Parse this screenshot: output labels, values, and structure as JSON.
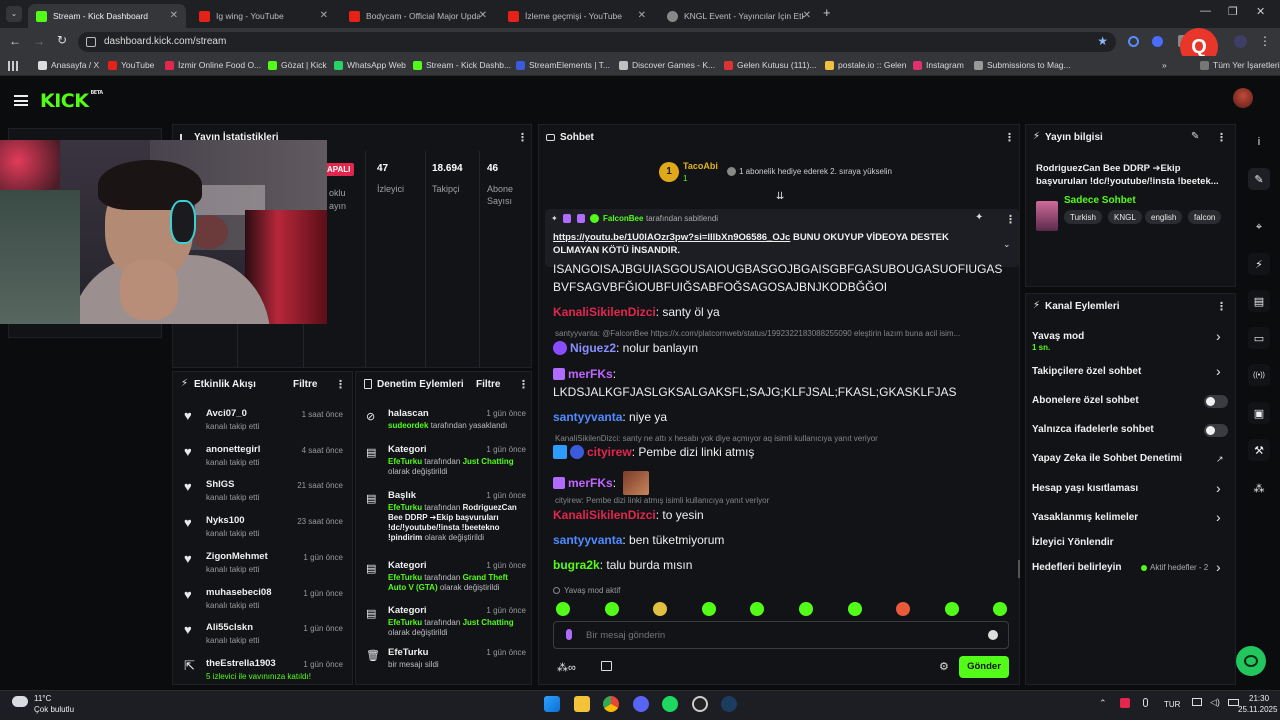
{
  "browser": {
    "tabs": [
      {
        "label": "Stream - Kick Dashboard",
        "icon": "kick-icon",
        "active": true
      },
      {
        "label": "Ig wing - YouTube",
        "icon": "youtube-icon"
      },
      {
        "label": "Bodycam - Official Major Upda",
        "icon": "youtube-icon"
      },
      {
        "label": "İzleme geçmişi - YouTube",
        "icon": "youtube-icon"
      },
      {
        "label": "KNGL Event - Yayıncılar İçin Etk",
        "icon": "globe-icon"
      }
    ],
    "url": "dashboard.kick.com/stream",
    "bookmarks": [
      "Anasayfa / X",
      "YouTube",
      "İzmir Online Food O...",
      "Gözat | Kick",
      "WhatsApp Web",
      "Stream - Kick Dashb...",
      "StreamElements | T...",
      "Discover Games - K...",
      "Gelen Kutusu (111)...",
      "postale.io :: Gelen",
      "Instagram",
      "Submissions to Mag..."
    ],
    "bookmarks_all": "Tüm Yer İşaretleri"
  },
  "kick": {
    "logo": "KICK",
    "beta": "BETA"
  },
  "stats": {
    "title": "Yayın İstatistikleri",
    "status": "APALI",
    "col1_label": [
      "oklu",
      "ayın"
    ],
    "items": [
      {
        "value": "47",
        "label": "İzleyici"
      },
      {
        "value": "18.694",
        "label": "Takipçi"
      },
      {
        "value": "46",
        "label": "Abone Sayısı"
      }
    ]
  },
  "activity": {
    "title": "Etkinlik Akışı",
    "filter": "Filtre",
    "items": [
      {
        "name": "Avci07_0",
        "sub": "kanalı takip etti",
        "time": "1 saat önce"
      },
      {
        "name": "anonettegirl",
        "sub": "kanalı takip etti",
        "time": "4 saat önce"
      },
      {
        "name": "ShIGS",
        "sub": "kanalı takip etti",
        "time": "21 saat önce"
      },
      {
        "name": "Nyks100",
        "sub": "kanalı takip etti",
        "time": "23 saat önce"
      },
      {
        "name": "ZigonMehmet",
        "sub": "kanalı takip etti",
        "time": "1 gün önce"
      },
      {
        "name": "muhasebeci08",
        "sub": "kanalı takip etti",
        "time": "1 gün önce"
      },
      {
        "name": "Ali55clskn",
        "sub": "kanalı takip etti",
        "time": "1 gün önce"
      },
      {
        "name": "theEstrella1903",
        "sub": "5 izlevici ile vavınınıza katıldı!",
        "time": "1 gün önce",
        "raid": true
      }
    ]
  },
  "moderation": {
    "title": "Denetim Eylemleri",
    "filter": "Filtre",
    "items": [
      {
        "title": "halascan",
        "time": "1 gün önce",
        "icon": "ban-icon",
        "lines": [
          [
            "sudeordek",
            "g"
          ],
          [
            " tarafından yasaklandı",
            "n"
          ]
        ]
      },
      {
        "title": "Kategori",
        "time": "1 gün önce",
        "icon": "category-icon",
        "lines": [
          [
            "EfeTurku",
            "g"
          ],
          [
            " tarafından ",
            "n"
          ],
          [
            "Just Chatting",
            "g"
          ],
          [
            " olarak değiştirildi",
            "n"
          ]
        ]
      },
      {
        "title": "Başlık",
        "time": "1 gün önce",
        "icon": "title-icon",
        "lines": [
          [
            "EfeTurku",
            "g"
          ],
          [
            " tarafından ",
            "n"
          ],
          [
            "RodriguezCan Bee DDRP ➔Ekip başvuruları !dc/!youtube/!insta !beetekno !pindirim",
            "w"
          ],
          [
            " olarak değiştirildi",
            "n"
          ]
        ]
      },
      {
        "title": "Kategori",
        "time": "1 gün önce",
        "icon": "category-icon",
        "lines": [
          [
            "EfeTurku",
            "g"
          ],
          [
            " tarafından ",
            "n"
          ],
          [
            "Grand Theft Auto V (GTA)",
            "g"
          ],
          [
            " olarak değiştirildi",
            "n"
          ]
        ]
      },
      {
        "title": "Kategori",
        "time": "1 gün önce",
        "icon": "category-icon",
        "lines": [
          [
            "EfeTurku",
            "g"
          ],
          [
            " tarafından ",
            "n"
          ],
          [
            "Just Chatting",
            "g"
          ],
          [
            " olarak değiştirildi",
            "n"
          ]
        ]
      },
      {
        "title": "EfeTurku",
        "time": "1 gün önce",
        "icon": "trash-icon",
        "lines": [
          [
            "bir mesajı sildi",
            "n"
          ]
        ]
      }
    ]
  },
  "chat": {
    "title": "Sohbet",
    "leader": {
      "rank": "1",
      "name": "TacoAbi",
      "count": "1",
      "hint": "1 abonelik hediye ederek 2. sıraya yükselin"
    },
    "pinned": {
      "by": "FalconBee",
      "by_suffix": "tarafından sabitlendi",
      "link": "https://youtu.be/1U0lAOzr3pw?si=lIlbXn9O6586_OJc",
      "text": " BUNU OKUYUP VİDEOYA DESTEK OLMAYAN KÖTÜ İNSANDIR."
    },
    "messages": [
      {
        "type": "plain",
        "text": "ISANGOISAJBGUIASGOUSAIOUGBASGOJBGAISGBFGASUBOUGASUOFIUGAS"
      },
      {
        "type": "plain",
        "text": "BVFSAGVBFĞIOUBFUIĞSABFOĞSAGOSAJBNJKODBĞĞOI"
      },
      {
        "type": "msg",
        "user": "KanaliSikilenDizci",
        "color": "#e2264d",
        "text": ": santy öl ya"
      },
      {
        "type": "reply",
        "text": "santyyvanta: @FalconBee https://x.com/platcornweb/status/1992322183088255090 eleştirin lazım buna acil isim..."
      },
      {
        "type": "msg",
        "user": "Niguez2",
        "color": "#8a8fff",
        "text": ": nolur banlayın",
        "badge": "purple"
      },
      {
        "type": "msg",
        "user": "merFKs",
        "color": "#c065ff",
        "text": ":",
        "badge": "gift"
      },
      {
        "type": "plain",
        "text": "LKDSJALKGFJASLGKSALGAKSFL;SAJG;KLFJSAL;FKASL;GKASKLFJAS"
      },
      {
        "type": "msg",
        "user": "santyyvanta",
        "color": "#4f8cff",
        "text": ": niye ya"
      },
      {
        "type": "reply",
        "text": "KanaliSikilenDizci: santy ne attı x hesabı yok diye açmıyor aq isimli kullanıcıya yanıt veriyor"
      },
      {
        "type": "msg",
        "user": "cityirew",
        "color": "#e2264d",
        "text": ": Pembe dizi linki atmış",
        "badge": "pair"
      },
      {
        "type": "msg",
        "user": "merFKs",
        "color": "#c065ff",
        "text": ":",
        "badge": "gift",
        "emote": true
      },
      {
        "type": "reply",
        "text": "cityirew: Pembe dizi linki atmış isimli kullanıcıya yanıt veriyor"
      },
      {
        "type": "msg",
        "user": "KanaliSikilenDizci",
        "color": "#e2264d",
        "text": ": to yesin"
      },
      {
        "type": "msg",
        "user": "santyyvanta",
        "color": "#4f8cff",
        "text": ": ben tüketmiyorum"
      },
      {
        "type": "msg",
        "user": "bugra2k",
        "color": "#53fc18",
        "text": ": talu burda mısın"
      }
    ],
    "slow_mode": "Yavaş mod aktif",
    "input_placeholder": "Bir mesaj gönderin",
    "send": "Gönder"
  },
  "stream_info": {
    "title": "Yayın bilgisi",
    "stream_title": "RodriguezCan Bee DDRP ➔Ekip başvuruları !dc/!youtube/!insta !beetek...",
    "category": "Sadece Sohbet",
    "tags": [
      "Turkish",
      "KNGL",
      "english",
      "falcon"
    ]
  },
  "channel_actions": {
    "title": "Kanal Eylemleri",
    "items": [
      {
        "label": "Yavaş mod",
        "sub": "1 sn.",
        "control": "chevron"
      },
      {
        "label": "Takipçilere özel sohbet",
        "control": "chevron"
      },
      {
        "label": "Abonelere özel sohbet",
        "control": "toggle"
      },
      {
        "label": "Yalnızca ifadelerle sohbet",
        "control": "toggle"
      },
      {
        "label": "Yapay Zeka ile Sohbet Denetimi",
        "control": "external"
      },
      {
        "label": "Hesap yaşı kısıtlaması",
        "control": "chevron"
      },
      {
        "label": "Yasaklanmış kelimeler",
        "control": "chevron"
      },
      {
        "label": "İzleyici Yönlendir",
        "control": "none"
      },
      {
        "label": "Hedefleri belirleyin",
        "control": "chevron",
        "extra": "Aktif hedefler - 2"
      }
    ]
  },
  "taskbar": {
    "weather_temp": "11°C",
    "weather_desc": "Çok bulutlu",
    "lang": "TUR",
    "time": "21:30",
    "date": "25.11.2025"
  }
}
